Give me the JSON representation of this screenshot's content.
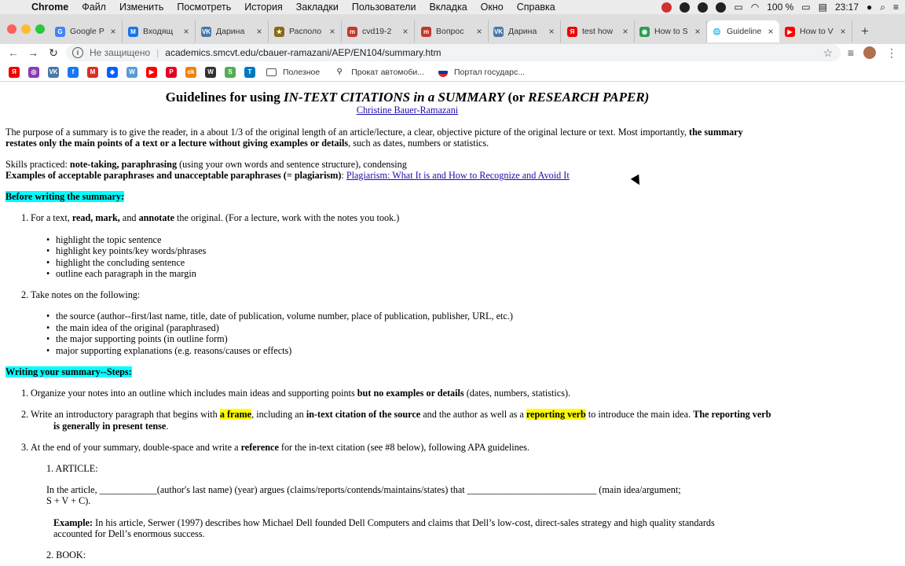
{
  "menubar": {
    "app": "Chrome",
    "items": [
      "Файл",
      "Изменить",
      "Посмотреть",
      "История",
      "Закладки",
      "Пользователи",
      "Вкладка",
      "Окно",
      "Справка"
    ],
    "battery": "100 %",
    "time": "23:17"
  },
  "tabs": [
    {
      "title": "Google P",
      "fav": "G",
      "color": "#4285f4"
    },
    {
      "title": "Входящ",
      "fav": "M",
      "color": "#1a73e8"
    },
    {
      "title": "Дарина",
      "fav": "VK",
      "color": "#4a76a8"
    },
    {
      "title": "Располо",
      "fav": "★",
      "color": "#8b6914"
    },
    {
      "title": "cvd19-2",
      "fav": "m",
      "color": "#c0392b"
    },
    {
      "title": "Вопрос",
      "fav": "m",
      "color": "#c0392b"
    },
    {
      "title": "Дарина",
      "fav": "VK",
      "color": "#4a76a8"
    },
    {
      "title": "test how",
      "fav": "Я",
      "color": "#e00"
    },
    {
      "title": "How to S",
      "fav": "◉",
      "color": "#2e9e4f"
    },
    {
      "title": "Guideline",
      "fav": "🌐",
      "color": "#555",
      "active": true
    },
    {
      "title": "How to V",
      "fav": "▶",
      "color": "#ff0000"
    }
  ],
  "toolbar": {
    "security_label": "Не защищено",
    "url": "academics.smcvt.edu/cbauer-ramazani/AEP/EN104/summary.htm"
  },
  "bookmarks": {
    "icons": [
      {
        "name": "yandex",
        "glyph": "Я",
        "color": "#e00"
      },
      {
        "name": "instagram",
        "glyph": "◎",
        "color": "#8a3ab9"
      },
      {
        "name": "vk",
        "glyph": "VK",
        "color": "#4a76a8"
      },
      {
        "name": "facebook",
        "glyph": "f",
        "color": "#1877f2"
      },
      {
        "name": "gmail",
        "glyph": "M",
        "color": "#d93025"
      },
      {
        "name": "dropbox",
        "glyph": "◆",
        "color": "#0061ff"
      },
      {
        "name": "wildberries",
        "glyph": "W",
        "color": "#5b9bd5"
      },
      {
        "name": "youtube",
        "glyph": "▶",
        "color": "#ff0000"
      },
      {
        "name": "pinterest",
        "glyph": "P",
        "color": "#e60023"
      },
      {
        "name": "ok",
        "glyph": "ok",
        "color": "#ee8208"
      },
      {
        "name": "wikipedia",
        "glyph": "W",
        "color": "#333"
      },
      {
        "name": "stepik",
        "glyph": "S",
        "color": "#54ad54"
      },
      {
        "name": "trello",
        "glyph": "T",
        "color": "#0079bf"
      }
    ],
    "items": [
      "Полезное",
      "Прокат автомоби...",
      "Портал государс..."
    ]
  },
  "page": {
    "title_pre": "Guidelines for using ",
    "title_em1": "IN-TEXT CITATIONS in a SUMMARY",
    "title_mid": " (or ",
    "title_em2": "RESEARCH PAPER)",
    "author": "Christine Bauer-Ramazani",
    "intro_1": "The purpose of a summary is to give the reader, in a about 1/3 of the original length of an article/lecture, a clear, objective picture of the original lecture or text.  Most importantly, ",
    "intro_1_bold": "the summary",
    "intro_2_bold": "restates only the main points of a text or a lecture without giving examples or details",
    "intro_2": ", such as dates, numbers or statistics.",
    "skills_pre": "Skills practiced: ",
    "skills_bold": "note-taking, paraphrasing",
    "skills_post": " (using your own words and sentence structure), condensing",
    "examples_bold": "Examples of acceptable paraphrases and unacceptable paraphrases (= plagiarism)",
    "examples_colon": ": ",
    "examples_link": "Plagiarism: What It is and How to Recognize and Avoid It",
    "before_heading": "Before writing the summary:",
    "step1_num": "1.",
    "step1_pre": "For a text, ",
    "step1_bold1": "read, mark,",
    "step1_and": " and ",
    "step1_bold2": "annotate",
    "step1_post": " the original.  (For a lecture, work with the notes you took.)",
    "step1_bullets": [
      "highlight the topic sentence",
      "highlight key points/key words/phrases",
      "highlight the concluding sentence",
      "outline each paragraph in the margin"
    ],
    "step2_num": "2.",
    "step2": "Take notes on the following:",
    "step2_bullets": [
      "the source (author--first/last name, title, date of publication, volume number, place of publication, publisher, URL, etc.)",
      "the main idea of the original (paraphrased)",
      "the major supporting points (in outline form)",
      "major supporting explanations (e.g. reasons/causes or effects)"
    ],
    "writing_heading": "Writing your summary--Steps:",
    "w1_num": "1.",
    "w1_pre": "Organize your notes into an outline which includes main ideas and supporting points ",
    "w1_bold": "but no examples or details",
    "w1_post": " (dates, numbers, statistics).",
    "w2_num": "2.",
    "w2_pre": "Write an introductory paragraph that begins with ",
    "w2_hl1": "a frame",
    "w2_mid1": ", including an ",
    "w2_bold1": "in-text citation of the source",
    "w2_mid2": " and the author as well as a ",
    "w2_hl2": "reporting verb",
    "w2_mid3": " to introduce the main idea. ",
    "w2_bold2": "The reporting verb",
    "w2_bold3": "is generally in present tense",
    "w2_end": ".",
    "w3_num": "3.",
    "w3_pre": "At the end of your summary, double-space and write a ",
    "w3_bold": "reference",
    "w3_post": " for the in-text citation (see #8 below), following APA guidelines.",
    "sub1": "1. ARTICLE:",
    "article_line1": "In the article, ____________(author's last name) (year) argues (claims/reports/contends/maintains/states) that  ___________________________ (main idea/argument;",
    "article_line2": "S + V + C).",
    "example_label": "Example:",
    "example_line1": "  In his article, Serwer (1997) describes how Michael Dell founded Dell Computers and claims that Dell’s low-cost, direct-sales strategy and high quality standards",
    "example_line2": "accounted for Dell’s enormous success.",
    "sub2": "2. BOOK:"
  }
}
